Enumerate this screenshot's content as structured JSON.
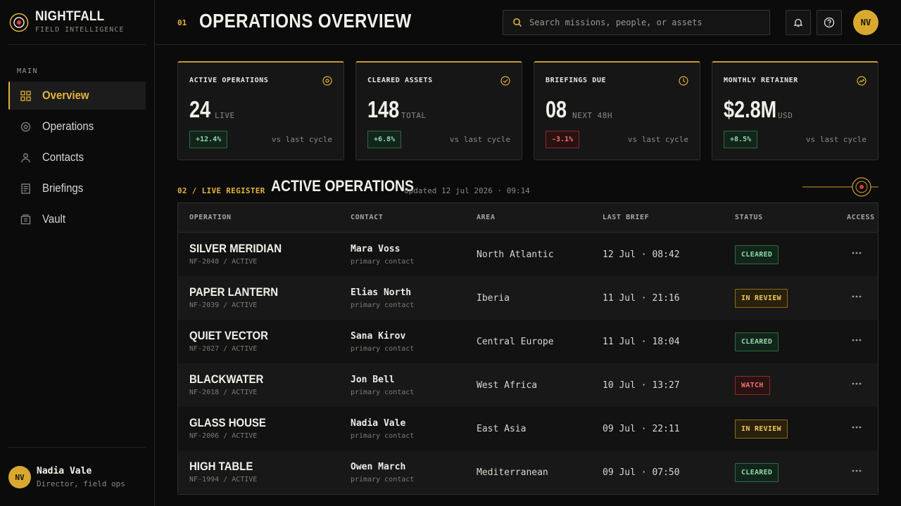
{
  "brand": {
    "name": "NIGHTFALL",
    "subtitle": "FIELD INTELLIGENCE"
  },
  "sidebar": {
    "section": "MAIN",
    "items": [
      {
        "label": "Overview",
        "icon": "grid-icon",
        "active": true
      },
      {
        "label": "Operations",
        "icon": "target-icon"
      },
      {
        "label": "Contacts",
        "icon": "person-icon"
      },
      {
        "label": "Briefings",
        "icon": "document-icon"
      },
      {
        "label": "Vault",
        "icon": "archive-icon"
      }
    ],
    "user": {
      "initials": "NV",
      "name": "Nadia Vale",
      "role": "Director, field ops"
    }
  },
  "header": {
    "number": "01",
    "title": "OPERATIONS OVERVIEW",
    "search_placeholder": "Search missions, people, or assets",
    "avatar": "NV"
  },
  "kpis": [
    {
      "label": "ACTIVE OPERATIONS",
      "value": "24",
      "unit": "LIVE",
      "delta": "+12.4%",
      "trend": "up",
      "compare": "vs last cycle",
      "icon": "target-icon"
    },
    {
      "label": "CLEARED ASSETS",
      "value": "148",
      "unit": "TOTAL",
      "delta": "+6.8%",
      "trend": "up",
      "compare": "vs last cycle",
      "icon": "check-circle-icon"
    },
    {
      "label": "BRIEFINGS DUE",
      "value": "08",
      "unit": "NEXT 48H",
      "delta": "-3.1%",
      "trend": "down",
      "compare": "vs last cycle",
      "icon": "clock-icon"
    },
    {
      "label": "MONTHLY RETAINER",
      "value": "$2.8M",
      "unit": "USD",
      "delta": "+8.5%",
      "trend": "up",
      "compare": "vs last cycle",
      "icon": "trend-up-icon"
    }
  ],
  "register": {
    "kicker": "02 / LIVE REGISTER",
    "title": "ACTIVE OPERATIONS",
    "updated": "updated 12 jul 2026 · 09:14",
    "columns": [
      "OPERATION",
      "CONTACT",
      "AREA",
      "LAST BRIEF",
      "STATUS",
      "ACCESS"
    ],
    "rows": [
      {
        "name": "SILVER MERIDIAN",
        "code": "NF-2048 / ACTIVE",
        "contact": "Mara Voss",
        "contact_role": "primary contact",
        "area": "North Atlantic",
        "brief": "12 Jul · 08:42",
        "status": "CLEARED",
        "status_kind": "cleared"
      },
      {
        "name": "PAPER LANTERN",
        "code": "NF-2039 / ACTIVE",
        "contact": "Elias North",
        "contact_role": "primary contact",
        "area": "Iberia",
        "brief": "11 Jul · 21:16",
        "status": "IN REVIEW",
        "status_kind": "review"
      },
      {
        "name": "QUIET VECTOR",
        "code": "NF-2027 / ACTIVE",
        "contact": "Sana Kirov",
        "contact_role": "primary contact",
        "area": "Central Europe",
        "brief": "11 Jul · 18:04",
        "status": "CLEARED",
        "status_kind": "cleared"
      },
      {
        "name": "BLACKWATER",
        "code": "NF-2018 / ACTIVE",
        "contact": "Jon Bell",
        "contact_role": "primary contact",
        "area": "West Africa",
        "brief": "10 Jul · 13:27",
        "status": "WATCH",
        "status_kind": "watch"
      },
      {
        "name": "GLASS HOUSE",
        "code": "NF-2006 / ACTIVE",
        "contact": "Nadia Vale",
        "contact_role": "primary contact",
        "area": "East Asia",
        "brief": "09 Jul · 22:11",
        "status": "IN REVIEW",
        "status_kind": "review"
      },
      {
        "name": "HIGH TABLE",
        "code": "NF-1994 / ACTIVE",
        "contact": "Owen March",
        "contact_role": "primary contact",
        "area": "Mediterranean",
        "brief": "09 Jul · 07:50",
        "status": "CLEARED",
        "status_kind": "cleared"
      }
    ]
  },
  "colors": {
    "accent": "#e3b23c",
    "background": "#0b0b0b",
    "positive": "#8fd9a8",
    "negative": "#f07070",
    "warning": "#eec55a"
  }
}
